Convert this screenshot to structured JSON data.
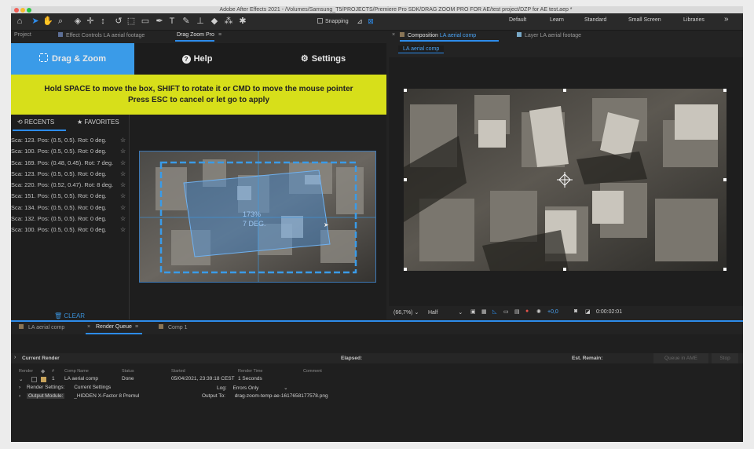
{
  "window": {
    "title": "Adobe After Effects 2021 - /Volumes/Samsung_T5/PROJECTS/Premiere Pro SDK/DRAG ZOOM PRO FOR AE/test project/DZP for AE test.aep *"
  },
  "toolbar": {
    "snapping_label": "Snapping",
    "workspaces": [
      "Default",
      "Learn",
      "Standard",
      "Small Screen",
      "Libraries"
    ],
    "more_label": "»"
  },
  "left_tabs": {
    "project": "Project",
    "effect_controls": "Effect Controls LA aerial footage",
    "dzp": "Drag Zoom Pro",
    "dzp_menu": "≡"
  },
  "dzp": {
    "tabs": {
      "drag_zoom": "Drag & Zoom",
      "help": "Help",
      "settings": "Settings"
    },
    "banner": {
      "line1": "Hold SPACE to move the box, SHIFT to rotate it or CMD to move the mouse pointer",
      "line2": "Press ESC to cancel or let go to apply"
    },
    "recents_label": "RECENTS",
    "favorites_label": "FAVORITES",
    "recents": [
      "Sca: 123. Pos: (0.5, 0.5). Rot: 0 deg.",
      "Sca: 100. Pos: (0.5, 0.5). Rot: 0 deg.",
      "Sca: 169. Pos: (0.48, 0.45). Rot: 7 deg.",
      "Sca: 123. Pos: (0.5, 0.5). Rot: 0 deg.",
      "Sca: 220. Pos: (0.52, 0.47). Rot: 8 deg.",
      "Sca: 151. Pos: (0.5, 0.5). Rot: 0 deg.",
      "Sca: 134. Pos: (0.5, 0.5). Rot: 0 deg.",
      "Sca: 132. Pos: (0.5, 0.5). Rot: 0 deg.",
      "Sca: 100. Pos: (0.5, 0.5). Rot: 0 deg."
    ],
    "clear_label": "CLEAR",
    "overlay_scale": "173%",
    "overlay_rotation": "7 DEG."
  },
  "viewer": {
    "comp_tab": "Composition",
    "comp_name": "LA aerial comp",
    "layer_tab": "Layer LA aerial footage",
    "breadcrumb": "LA aerial comp",
    "zoom": "(66,7%)",
    "resolution": "Half",
    "exposure": "+0,0",
    "timecode": "0:00:02:01"
  },
  "render_queue": {
    "tabs": [
      "LA aerial comp",
      "Render Queue",
      "Comp 1"
    ],
    "current_render_label": "Current Render",
    "elapsed_label": "Elapsed:",
    "est_remain_label": "Est. Remain:",
    "queue_in_ame_label": "Queue in AME",
    "stop_label": "Stop",
    "columns": [
      "Render",
      "#",
      "Comp Name",
      "Status",
      "Started",
      "Render Time",
      "Comment"
    ],
    "row": {
      "number": "1",
      "comp_name": "LA aerial comp",
      "status": "Done",
      "started": "05/04/2021, 23:39:18 CEST",
      "render_time": "1 Seconds"
    },
    "render_settings_label": "Render Settings:",
    "render_settings_value": "Current Settings",
    "log_label": "Log:",
    "log_value": "Errors Only",
    "output_module_label": "Output Module:",
    "output_module_value": "_HIDDEN X-Factor 8 Premul",
    "output_to_label": "Output To:",
    "output_to_value": "drag-zoom-temp-ae-1617658177578.png"
  },
  "colors": {
    "accent_blue": "#3a9be8",
    "banner_yellow": "#d7df1a",
    "panel_bg": "#1e1e1e"
  }
}
